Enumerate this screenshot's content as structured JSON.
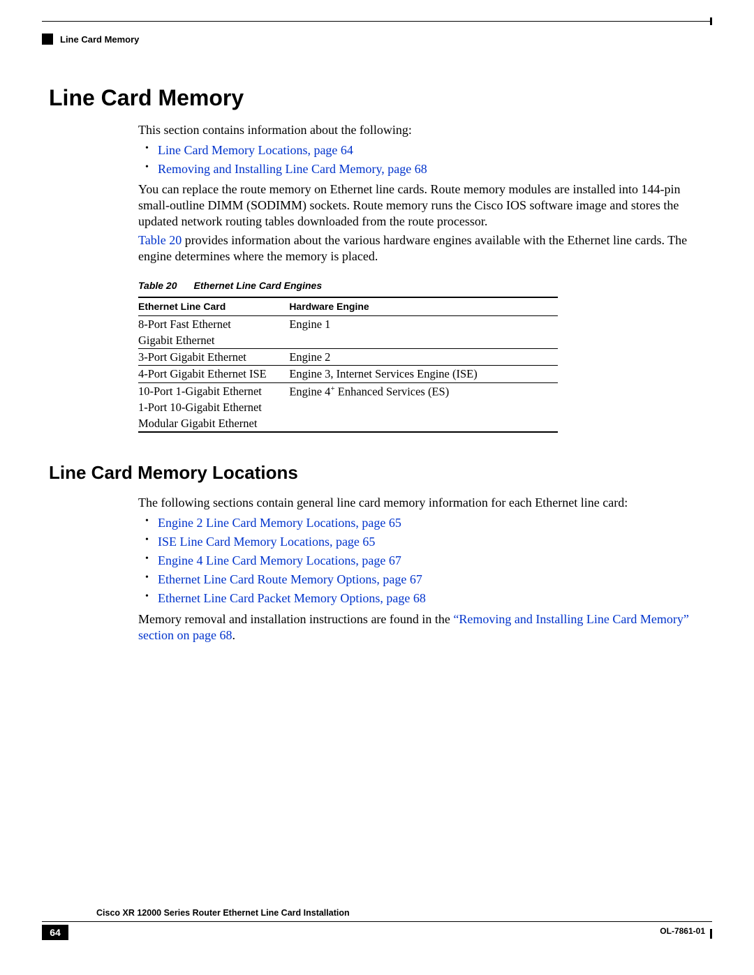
{
  "header": {
    "running_title": "Line Card Memory"
  },
  "headings": {
    "main": "Line Card Memory",
    "sub": "Line Card Memory Locations"
  },
  "intro": {
    "line1": "This section contains information about the following:",
    "bullets": [
      "Line Card Memory Locations, page 64",
      "Removing and Installing Line Card Memory, page 68"
    ],
    "para1": "You can replace the route memory on Ethernet line cards. Route memory modules are installed into 144-pin small-outline DIMM (SODIMM) sockets. Route memory runs the Cisco IOS software image and stores the updated network routing tables downloaded from the route processor.",
    "para2_prefix": "Table 20",
    "para2_rest": " provides information about the various hardware engines available with the Ethernet line cards. The engine determines where the memory is placed."
  },
  "table": {
    "caption_label": "Table 20",
    "caption_title": "Ethernet Line Card Engines",
    "col1": "Ethernet Line Card",
    "col2": "Hardware Engine",
    "rows": [
      {
        "c1": "8-Port Fast Ethernet",
        "c2": "Engine 1",
        "sep": false
      },
      {
        "c1": "Gigabit Ethernet",
        "c2": "",
        "sep": true
      },
      {
        "c1": "3-Port Gigabit Ethernet",
        "c2": "Engine 2",
        "sep": true
      },
      {
        "c1": "4-Port Gigabit Ethernet ISE",
        "c2": "Engine 3, Internet Services Engine (ISE)",
        "sep": true
      },
      {
        "c1": "10-Port 1-Gigabit Ethernet",
        "c2_pre": "Engine 4",
        "c2_sup": "+",
        "c2_post": " Enhanced Services (ES)",
        "sep": false
      },
      {
        "c1": "1-Port 10-Gigabit Ethernet",
        "c2": "",
        "sep": false
      },
      {
        "c1": "Modular Gigabit Ethernet",
        "c2": "",
        "sep": false,
        "last": true
      }
    ]
  },
  "locations": {
    "intro": "The following sections contain general line card memory information for each Ethernet line card:",
    "bullets": [
      "Engine 2 Line Card Memory Locations, page 65",
      "ISE Line Card Memory Locations, page 65",
      "Engine 4 Line Card Memory Locations, page 67",
      "Ethernet Line Card Route Memory Options, page 67",
      "Ethernet Line Card Packet Memory Options, page 68"
    ],
    "closing_pre": "Memory removal and installation instructions are found in the ",
    "closing_link": "“Removing and Installing Line Card Memory” section on page 68",
    "closing_post": "."
  },
  "footer": {
    "book_title": "Cisco XR 12000 Series Router Ethernet Line Card Installation",
    "page_number": "64",
    "doc_id": "OL-7861-01"
  }
}
